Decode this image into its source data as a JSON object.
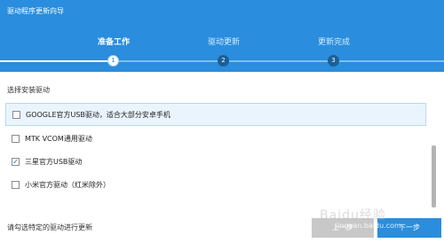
{
  "window": {
    "title": "驱动程序更新向导"
  },
  "steps": [
    {
      "label": "准备工作",
      "number": "1",
      "active": true
    },
    {
      "label": "驱动更新",
      "number": "2",
      "active": false
    },
    {
      "label": "更新完成",
      "number": "3",
      "active": false
    }
  ],
  "section_label": "选择安装驱动",
  "drivers": [
    {
      "label": "GOOGLE官方USB驱动，适合大部分安卓手机",
      "checked": false,
      "highlighted": true
    },
    {
      "label": "MTK VCOM通用驱动",
      "checked": false,
      "highlighted": false
    },
    {
      "label": "三星官方USB驱动",
      "checked": true,
      "highlighted": false
    },
    {
      "label": "小米官方驱动（红米除外）",
      "checked": false,
      "highlighted": false
    }
  ],
  "footer": {
    "hint": "请勾选特定的驱动进行更新",
    "prev_label": "上一步",
    "next_label": "下一步"
  },
  "watermark": {
    "logo": "Baidu经验",
    "url": "jingyan.baidu.com"
  },
  "colors": {
    "accent": "#2a8ddd",
    "step_inactive_dot": "#1c5f96",
    "button_disabled": "#c8c8c8"
  }
}
